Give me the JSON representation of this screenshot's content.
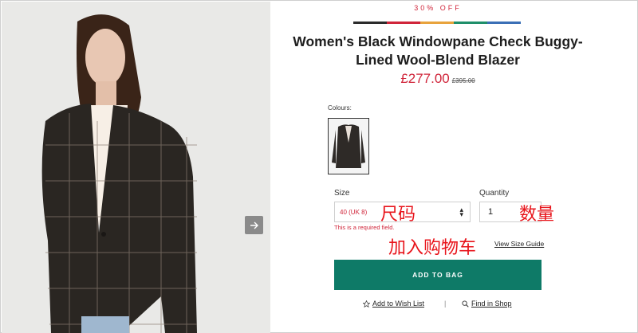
{
  "product": {
    "sale_tag": "30% OFF",
    "title": "Women's Black Windowpane Check Buggy-Lined Wool-Blend Blazer",
    "price": "£277.00",
    "old_price": "£395.00"
  },
  "stripe_colors": [
    "#2b2b2b",
    "#d0253a",
    "#e8a33c",
    "#1f8f6a",
    "#3b6fb6"
  ],
  "colours": {
    "label": "Colours:"
  },
  "size": {
    "label": "Size",
    "selected": "40 (UK 8)",
    "error": "This is a required field."
  },
  "quantity": {
    "label": "Quantity",
    "value": "1"
  },
  "annotations": {
    "size": "尺码",
    "quantity": "数量",
    "cart": "加入购物车"
  },
  "actions": {
    "size_guide": "View Size Guide",
    "add_to_bag": "ADD TO BAG",
    "wish_list": "Add to Wish List",
    "separator": "|",
    "find_in_shop": "Find in Shop"
  },
  "icons": {
    "next": "arrow-right-icon",
    "star": "star-icon",
    "search": "search-icon"
  }
}
